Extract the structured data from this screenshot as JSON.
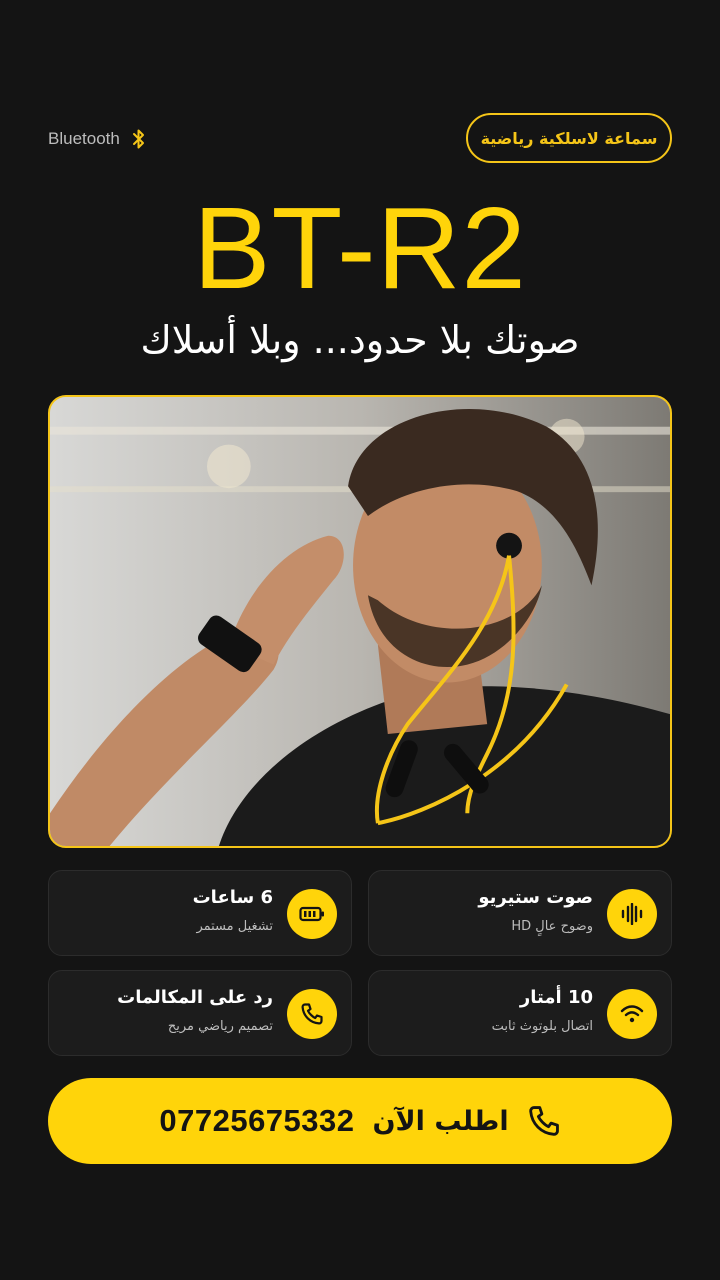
{
  "header": {
    "bluetooth_label": "Bluetooth",
    "badge": "سماعة لاسلكية رياضية"
  },
  "hero": {
    "model": "BT-R2",
    "tagline": "صوتك بلا حدود... وبلا أسلاك"
  },
  "features": [
    {
      "title": "صوت ستيريو",
      "subtitle": "وضوح عالٍ HD",
      "icon": "sound-wave-icon"
    },
    {
      "title": "6 ساعات",
      "subtitle": "تشغيل مستمر",
      "icon": "battery-icon"
    },
    {
      "title": "10 أمتار",
      "subtitle": "اتصال بلوتوث ثابت",
      "icon": "wifi-icon"
    },
    {
      "title": "رد على المكالمات",
      "subtitle": "تصميم رياضي مريح",
      "icon": "phone-icon"
    }
  ],
  "cta": {
    "label": "اطلب الآن",
    "phone": "07725675332"
  },
  "colors": {
    "accent": "#ffd40a",
    "background": "#141414",
    "card": "#1c1c1c"
  }
}
